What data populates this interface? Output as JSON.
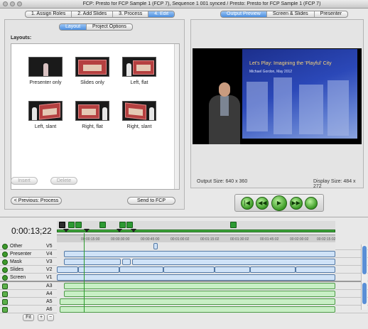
{
  "window": {
    "title": "FCP: Presto for FCP Sample 1 (FCP 7), Sequence 1 001 synced / Presto: Presto for FCP Sample 1 (FCP 7)"
  },
  "workflow_tabs": [
    "1. Assign Roles",
    "2. Add Slides",
    "3. Process",
    "4. Edit"
  ],
  "workflow_active": "4. Edit",
  "edit_tabs": [
    "Layout",
    "Project Options"
  ],
  "edit_active": "Layout",
  "preview_tabs": [
    "Output Preview",
    "Screen & Slides",
    "Presenter"
  ],
  "preview_active": "Output Preview",
  "layouts": {
    "label": "Layouts:",
    "items": [
      {
        "label": "Presenter only"
      },
      {
        "label": "Slides only"
      },
      {
        "label": "Left, flat"
      },
      {
        "label": "Left, slant"
      },
      {
        "label": "Right, flat"
      },
      {
        "label": "Right, slant"
      }
    ],
    "insert_label": "Insert",
    "delete_label": "Delete"
  },
  "nav": {
    "previous_label": "< Previous: Process",
    "send_label": "Send to FCP"
  },
  "preview": {
    "slide_title": "Let's Play: Imagining the 'Playful' City",
    "slide_subtitle": "Michael Gordon, May 2012",
    "output_size": "Output Size: 640 x 360",
    "display_size": "Display Size: 484 x 272"
  },
  "controls": [
    {
      "name": "go-to-start-icon",
      "glyph": "|◀"
    },
    {
      "name": "rewind-icon",
      "glyph": "◀◀"
    },
    {
      "name": "play-icon",
      "glyph": "▶"
    },
    {
      "name": "fast-forward-icon",
      "glyph": "▶▶"
    },
    {
      "name": "stop-icon",
      "glyph": ""
    }
  ],
  "timeline": {
    "timecode": "0:00:13;22",
    "ruler_ticks": [
      "00:00:15:00",
      "00:00:30:00",
      "00:00:45:00",
      "00:01:00:02",
      "00:01:15:02",
      "00:01:30:02",
      "00:01:45:02",
      "00:02:00:02",
      "00:02:15:02"
    ],
    "tracks": [
      {
        "name": "Other",
        "id": "V5",
        "kind": "video"
      },
      {
        "name": "Presenter",
        "id": "V4",
        "kind": "video"
      },
      {
        "name": "Mask",
        "id": "V3",
        "kind": "video"
      },
      {
        "name": "Slides",
        "id": "V2",
        "kind": "video"
      },
      {
        "name": "Screen",
        "id": "V1",
        "kind": "video"
      },
      {
        "name": "",
        "id": "A3",
        "kind": "audio"
      },
      {
        "name": "",
        "id": "A4",
        "kind": "audio"
      },
      {
        "name": "",
        "id": "A5",
        "kind": "audio"
      },
      {
        "name": "",
        "id": "A6",
        "kind": "audio"
      }
    ],
    "fit_label": "Fit",
    "zoom_in_label": "+",
    "zoom_out_label": "−"
  },
  "colors": {
    "accent_tab": "#4c8fe0",
    "video_clip": "#cfe2f7",
    "audio_clip": "#c8efc5",
    "sync_bar": "#3ea83a"
  }
}
